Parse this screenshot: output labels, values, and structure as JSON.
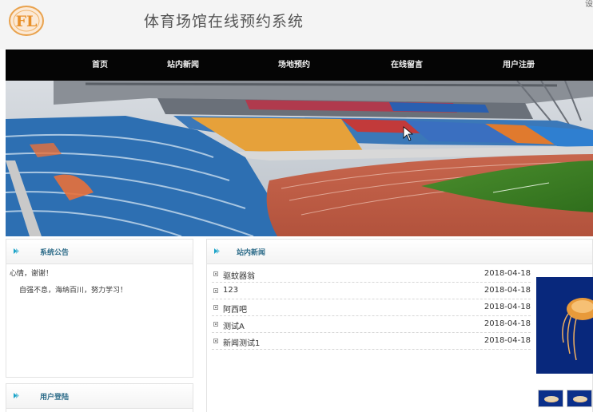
{
  "header": {
    "title": "体育场馆在线预约系统",
    "logo_text": "FL",
    "corner_text": "设"
  },
  "nav": {
    "items": [
      {
        "label": "首页"
      },
      {
        "label": "站内新闻"
      },
      {
        "label": "场地预约"
      },
      {
        "label": "在线留言"
      },
      {
        "label": "用户注册"
      }
    ]
  },
  "notice": {
    "title": "系统公告",
    "lines": [
      "心情，谢谢！",
      "自强不息，海纳百川，努力学习！"
    ]
  },
  "news": {
    "title": "站内新闻",
    "items": [
      {
        "title": "驱蚊器翁",
        "date": "2018-04-18"
      },
      {
        "title": "123",
        "date": "2018-04-18"
      },
      {
        "title": "阿西吧",
        "date": "2018-04-18"
      },
      {
        "title": "测试A",
        "date": "2018-04-18"
      },
      {
        "title": "新闻测试1",
        "date": "2018-04-18"
      }
    ]
  },
  "login": {
    "title": "用户登陆"
  },
  "colors": {
    "nav_bg": "#050505",
    "panel_title": "#2f6d8a",
    "arrow": "#1aa3c8"
  }
}
